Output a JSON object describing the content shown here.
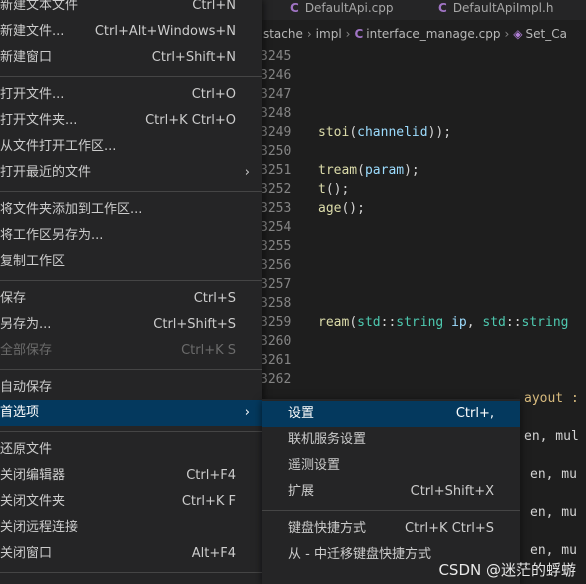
{
  "tabs": [
    {
      "icon": "C",
      "label": "DefaultApi.cpp"
    },
    {
      "icon": "C",
      "label": "DefaultApiImpl.h"
    }
  ],
  "breadcrumb": {
    "seg1": "pistache",
    "seg2": "impl",
    "file_icon": "C",
    "file": "interface_manage.cpp",
    "symbol": "Set_Ca"
  },
  "code": {
    "line_numbers": [
      "3245",
      "3246",
      "3247",
      "3248",
      "3249",
      "3250",
      "3251",
      "3252",
      "3253",
      "3254",
      "3255",
      "3256",
      "3257",
      "3258",
      "3259",
      "3260",
      "3261",
      "3262"
    ],
    "l3249": {
      "fn": "stoi",
      "p1": "(",
      "var": "channelid",
      "p2": "));"
    },
    "l3251": {
      "fn": "tream",
      "p1": "(",
      "var": "param",
      "p2": ");"
    },
    "l3252": {
      "fn": "t",
      "p2": "();"
    },
    "l3253": {
      "fn": "age",
      "p2": "();"
    },
    "l3259": {
      "fn": "ream",
      "p1": "(",
      "ns": "std",
      "c1": "::",
      "type": "string",
      "var": " ip",
      "p2": ", ",
      "ns2": "std",
      "c2": "::",
      "type2": "string"
    },
    "tail1": "ayout :",
    "tail2": "en, mul",
    "tail3": "en, mu",
    "tail4": "en, mu",
    "tail5": "en, mu"
  },
  "menu": {
    "items": [
      {
        "label": "新建文本文件",
        "shortcut": "Ctrl+N"
      },
      {
        "label": "新建文件...",
        "shortcut": "Ctrl+Alt+Windows+N"
      },
      {
        "label": "新建窗口",
        "shortcut": "Ctrl+Shift+N"
      },
      {
        "label": "打开文件...",
        "shortcut": "Ctrl+O"
      },
      {
        "label": "打开文件夹...",
        "shortcut": "Ctrl+K Ctrl+O"
      },
      {
        "label": "从文件打开工作区...",
        "shortcut": ""
      },
      {
        "label": "打开最近的文件",
        "shortcut": ""
      },
      {
        "label": "将文件夹添加到工作区...",
        "shortcut": ""
      },
      {
        "label": "将工作区另存为...",
        "shortcut": ""
      },
      {
        "label": "复制工作区",
        "shortcut": ""
      },
      {
        "label": "保存",
        "shortcut": "Ctrl+S"
      },
      {
        "label": "另存为...",
        "shortcut": "Ctrl+Shift+S"
      },
      {
        "label": "全部保存",
        "shortcut": "Ctrl+K S"
      },
      {
        "label": "自动保存",
        "shortcut": ""
      },
      {
        "label": "首选项",
        "shortcut": ""
      },
      {
        "label": "还原文件",
        "shortcut": ""
      },
      {
        "label": "关闭编辑器",
        "shortcut": "Ctrl+F4"
      },
      {
        "label": "关闭文件夹",
        "shortcut": "Ctrl+K F"
      },
      {
        "label": "关闭远程连接",
        "shortcut": ""
      },
      {
        "label": "关闭窗口",
        "shortcut": "Alt+F4"
      }
    ],
    "submenu_arrow": "›"
  },
  "submenu": {
    "items": [
      {
        "label": "设置",
        "shortcut": "Ctrl+,"
      },
      {
        "label": "联机服务设置",
        "shortcut": ""
      },
      {
        "label": "遥测设置",
        "shortcut": ""
      },
      {
        "label": "扩展",
        "shortcut": "Ctrl+Shift+X"
      },
      {
        "label": "键盘快捷方式",
        "shortcut": "Ctrl+K Ctrl+S"
      },
      {
        "label": "从 - 中迁移键盘快捷方式",
        "shortcut": ""
      }
    ]
  },
  "watermark": "CSDN @迷茫的蜉蝣",
  "colors": {
    "menu_bg": "#252526",
    "highlight": "#04395e",
    "editor_bg": "#1e1e1e"
  }
}
